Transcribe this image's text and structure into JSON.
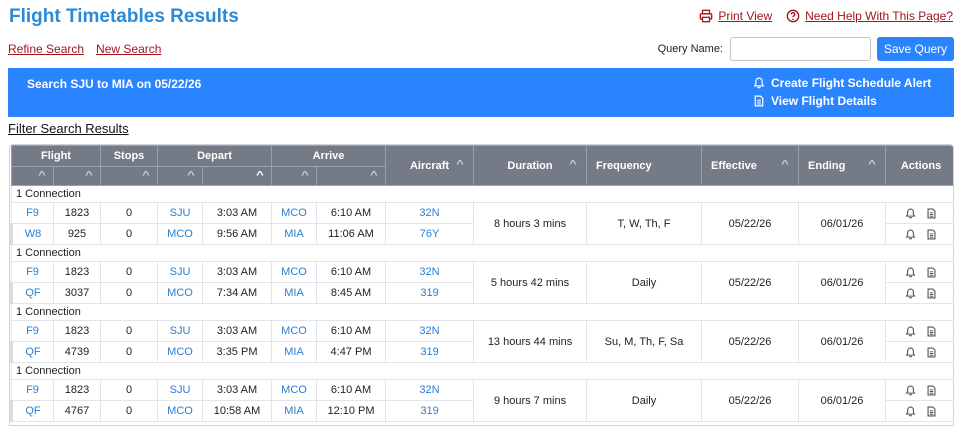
{
  "page": {
    "title": "Flight Timetables Results",
    "print_view": "Print View",
    "help": "Need Help With This Page?",
    "refine_search": "Refine Search",
    "new_search": "New Search",
    "query_label": "Query Name:",
    "query_value": "",
    "save_query": "Save Query"
  },
  "banner": {
    "search_text": "Search SJU to MIA on 05/22/26",
    "create_alert": "Create Flight Schedule Alert",
    "view_details": "View Flight Details"
  },
  "filter_title": "Filter Search Results",
  "colors": {
    "title_blue": "#2a8ad8",
    "banner_blue": "#2b84ff",
    "link_red": "#a3151e",
    "header_gray": "#747b86",
    "code_blue": "#2a7ed2"
  },
  "icons": [
    "print-icon",
    "help-circle-icon",
    "bell-icon",
    "document-icon",
    "sort-caret-icon"
  ],
  "table": {
    "headers": {
      "flight": "Flight",
      "stops": "Stops",
      "depart": "Depart",
      "arrive": "Arrive",
      "aircraft": "Aircraft",
      "duration": "Duration",
      "frequency": "Frequency",
      "effective": "Effective",
      "ending": "Ending",
      "actions": "Actions"
    },
    "groups": [
      {
        "label": "1 Connection",
        "duration": "8 hours 3 mins",
        "frequency": "T, W, Th, F",
        "effective": "05/22/26",
        "ending": "06/01/26",
        "legs": [
          {
            "airline": "F9",
            "number": "1823",
            "stops": "0",
            "dep_airport": "SJU",
            "dep_time": "3:03 AM",
            "arr_airport": "MCO",
            "arr_time": "6:10 AM",
            "aircraft": "32N"
          },
          {
            "airline": "W8",
            "number": "925",
            "stops": "0",
            "dep_airport": "MCO",
            "dep_time": "9:56 AM",
            "arr_airport": "MIA",
            "arr_time": "11:06 AM",
            "aircraft": "76Y"
          }
        ]
      },
      {
        "label": "1 Connection",
        "duration": "5 hours 42 mins",
        "frequency": "Daily",
        "effective": "05/22/26",
        "ending": "06/01/26",
        "legs": [
          {
            "airline": "F9",
            "number": "1823",
            "stops": "0",
            "dep_airport": "SJU",
            "dep_time": "3:03 AM",
            "arr_airport": "MCO",
            "arr_time": "6:10 AM",
            "aircraft": "32N"
          },
          {
            "airline": "QF",
            "number": "3037",
            "stops": "0",
            "dep_airport": "MCO",
            "dep_time": "7:34 AM",
            "arr_airport": "MIA",
            "arr_time": "8:45 AM",
            "aircraft": "319"
          }
        ]
      },
      {
        "label": "1 Connection",
        "duration": "13 hours 44 mins",
        "frequency": "Su, M, Th, F, Sa",
        "effective": "05/22/26",
        "ending": "06/01/26",
        "legs": [
          {
            "airline": "F9",
            "number": "1823",
            "stops": "0",
            "dep_airport": "SJU",
            "dep_time": "3:03 AM",
            "arr_airport": "MCO",
            "arr_time": "6:10 AM",
            "aircraft": "32N"
          },
          {
            "airline": "QF",
            "number": "4739",
            "stops": "0",
            "dep_airport": "MCO",
            "dep_time": "3:35 PM",
            "arr_airport": "MIA",
            "arr_time": "4:47 PM",
            "aircraft": "319"
          }
        ]
      },
      {
        "label": "1 Connection",
        "duration": "9 hours 7 mins",
        "frequency": "Daily",
        "effective": "05/22/26",
        "ending": "06/01/26",
        "legs": [
          {
            "airline": "F9",
            "number": "1823",
            "stops": "0",
            "dep_airport": "SJU",
            "dep_time": "3:03 AM",
            "arr_airport": "MCO",
            "arr_time": "6:10 AM",
            "aircraft": "32N"
          },
          {
            "airline": "QF",
            "number": "4767",
            "stops": "0",
            "dep_airport": "MCO",
            "dep_time": "10:58 AM",
            "arr_airport": "MIA",
            "arr_time": "12:10 PM",
            "aircraft": "319"
          }
        ]
      }
    ]
  }
}
